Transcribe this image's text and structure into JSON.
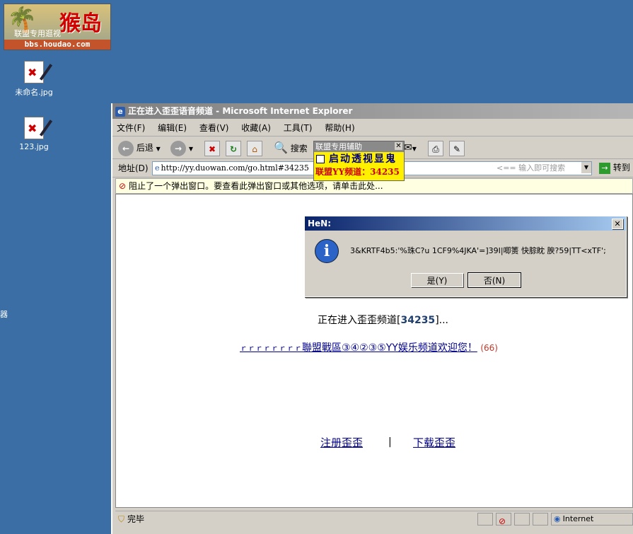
{
  "desktop": {
    "logo": {
      "big": "猴岛",
      "small": "联盟专用逛视",
      "url": "bbs.houdao.com"
    },
    "icons": [
      {
        "label": "未命名.jpg"
      },
      {
        "label": "123.jpg"
      }
    ],
    "edge_char": "器"
  },
  "window": {
    "title": "正在进入歪歪语音频道 - Microsoft Internet Explorer",
    "menu": [
      "文件(F)",
      "编辑(E)",
      "查看(V)",
      "收藏(A)",
      "工具(T)",
      "帮助(H)"
    ],
    "toolbar": {
      "back_label": "后退",
      "search_label": "搜索"
    },
    "address": {
      "label": "地址(D)",
      "url": "http://yy.duowan.com/go.html#34235",
      "search_hint": "<== 输入即可搜索",
      "go_label": "转到"
    },
    "notify": "阻止了一个弹出窗口。要查看此弹出窗口或其他选项，请单击此处...",
    "status": {
      "text": "完毕",
      "zone": "Internet"
    }
  },
  "popup": {
    "title": "联盟专用辅助",
    "option": "启动透视显鬼",
    "channel": "联盟YY频道：34235"
  },
  "dialog": {
    "title": "HeN:",
    "message": "3&KRTF4b5:'%珠C?u  1CF9%4JKA'=]39I|唧箦  快腙眈  腴?59|TT<xTF';",
    "yes": "是(Y)",
    "no": "否(N)"
  },
  "page": {
    "entering_prefix": "正在进入歪歪频道[",
    "channel_id": "34235",
    "entering_suffix": "]...",
    "welcome_prefix": "ｒｒｒｒｒｒｒｒ",
    "welcome": "聯盟戰區③④②③⑤YY娱乐频道欢迎您！",
    "count": "(66)",
    "register": "注册歪歪",
    "separator": "|",
    "download": "下载歪歪"
  }
}
